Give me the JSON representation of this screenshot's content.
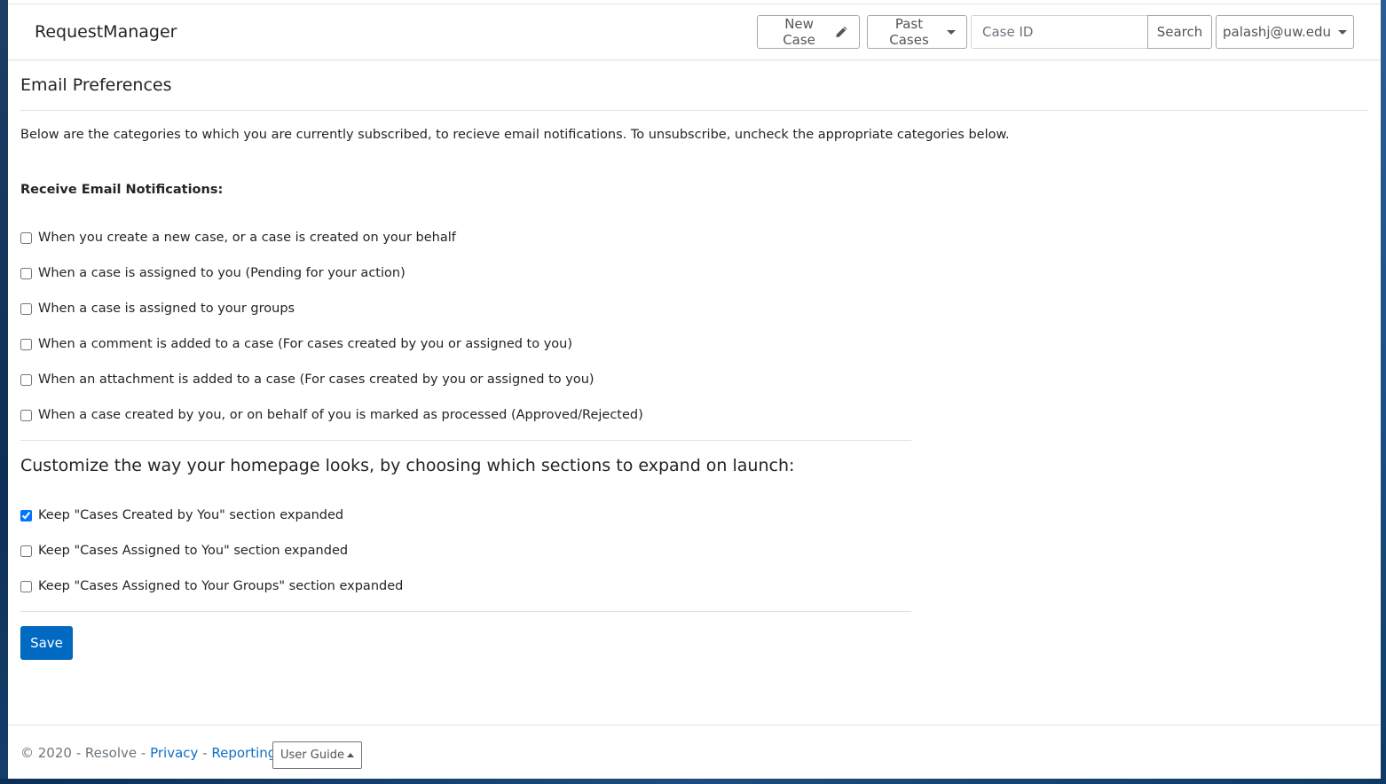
{
  "header": {
    "brand": "RequestManager",
    "new_case_label": "New Case",
    "past_cases_label": "Past Cases",
    "case_id_placeholder": "Case ID",
    "search_label": "Search",
    "user_label": "palashj@uw.edu"
  },
  "main": {
    "title": "Email Preferences",
    "intro": "Below are the categories to which you are currently subscribed, to recieve email notifications. To unsubscribe, uncheck the appropriate categories below.",
    "notifications_label": "Receive Email Notifications:",
    "notifications": [
      {
        "label": "When you create a new case, or a case is created on your behalf",
        "checked": false
      },
      {
        "label": "When a case is assigned to you (Pending for your action)",
        "checked": false
      },
      {
        "label": "When a case is assigned to your groups",
        "checked": false
      },
      {
        "label": "When a comment is added to a case (For cases created by you or assigned to you)",
        "checked": false
      },
      {
        "label": "When an attachment is added to a case (For cases created by you or assigned to you)",
        "checked": false
      },
      {
        "label": "When a case created by you, or on behalf of you is marked as processed (Approved/Rejected)",
        "checked": false
      }
    ],
    "customize_heading": "Customize the way your homepage looks, by choosing which sections to expand on launch:",
    "homepage_sections": [
      {
        "label": "Keep \"Cases Created by You\" section expanded",
        "checked": true
      },
      {
        "label": "Keep \"Cases Assigned to You\" section expanded",
        "checked": false
      },
      {
        "label": "Keep \"Cases Assigned to Your Groups\" section expanded",
        "checked": false
      }
    ],
    "save_label": "Save"
  },
  "footer": {
    "copyright": "© 2020 - Resolve - ",
    "privacy": "Privacy",
    "separator": " - ",
    "reporting": "Reporting",
    "user_guide": "User Guide"
  },
  "colors": {
    "primary": "#0069c2",
    "link": "#0f6fc6"
  }
}
